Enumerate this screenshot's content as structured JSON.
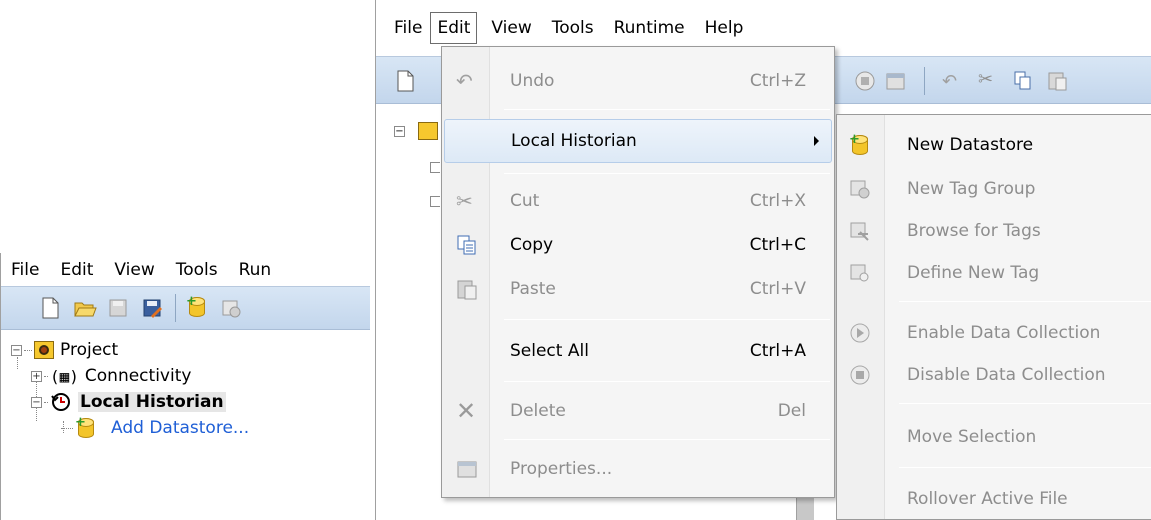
{
  "left_panel": {
    "menu": [
      "File",
      "Edit",
      "View",
      "Tools",
      "Run"
    ],
    "tree": {
      "root": "Project",
      "connectivity": "Connectivity",
      "historian": "Local Historian",
      "add_datastore": "Add Datastore..."
    }
  },
  "main_window": {
    "menu": [
      "File",
      "Edit",
      "View",
      "Tools",
      "Runtime",
      "Help"
    ],
    "active_menu": "Edit"
  },
  "edit_menu": {
    "items": [
      {
        "label": "Undo",
        "shortcut": "Ctrl+Z",
        "icon": "undo-icon",
        "enabled": false
      },
      {
        "label": "Local Historian",
        "shortcut": "",
        "icon": "",
        "enabled": true,
        "submenu": true
      },
      {
        "label": "Cut",
        "shortcut": "Ctrl+X",
        "icon": "scissors-icon",
        "enabled": false
      },
      {
        "label": "Copy",
        "shortcut": "Ctrl+C",
        "icon": "copy-icon",
        "enabled": true
      },
      {
        "label": "Paste",
        "shortcut": "Ctrl+V",
        "icon": "paste-icon",
        "enabled": false
      },
      {
        "label": "Select All",
        "shortcut": "Ctrl+A",
        "icon": "",
        "enabled": true
      },
      {
        "label": "Delete",
        "shortcut": "Del",
        "icon": "delete-x-icon",
        "enabled": false
      },
      {
        "label": "Properties...",
        "shortcut": "",
        "icon": "properties-icon",
        "enabled": false
      }
    ]
  },
  "submenu": {
    "items": [
      {
        "label": "New Datastore",
        "icon": "datastore-icon",
        "enabled": true
      },
      {
        "label": "New Tag Group",
        "icon": "tag-group-icon",
        "enabled": false
      },
      {
        "label": "Browse for Tags",
        "icon": "browse-tags-icon",
        "enabled": false
      },
      {
        "label": "Define New Tag",
        "icon": "define-tag-icon",
        "enabled": false
      },
      {
        "label": "Enable Data Collection",
        "icon": "play-circle-icon",
        "enabled": false
      },
      {
        "label": "Disable Data Collection",
        "icon": "stop-circle-icon",
        "enabled": false
      },
      {
        "label": "Move Selection",
        "icon": "",
        "enabled": false
      },
      {
        "label": "Rollover Active File",
        "icon": "",
        "enabled": false
      }
    ]
  },
  "colors": {
    "toolbar_top": "#d8e6f5",
    "toolbar_bottom": "#c3d6ec",
    "link_blue": "#1f5fd6",
    "disabled_text": "#8d8d8d",
    "highlight_border": "#b6cde9"
  }
}
